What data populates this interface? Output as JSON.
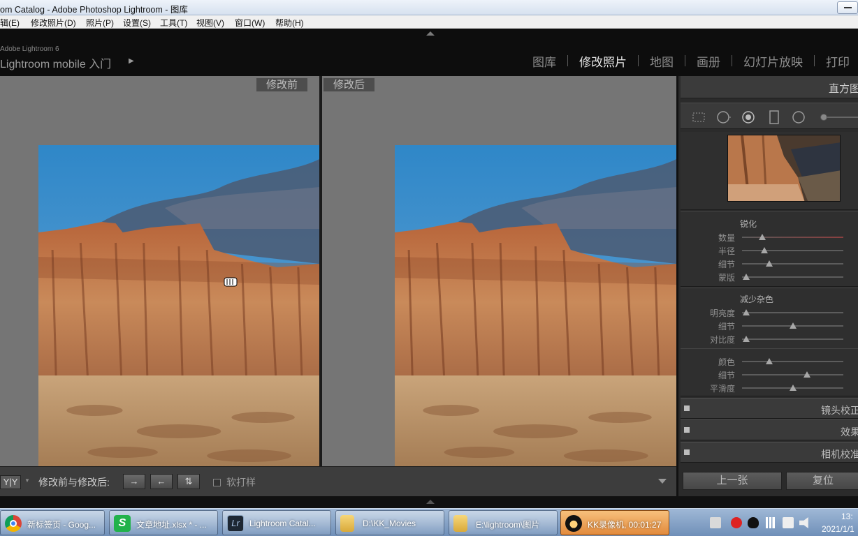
{
  "window": {
    "title": "om Catalog - Adobe Photoshop Lightroom - 图库"
  },
  "menu": [
    {
      "label": "辑(E)"
    },
    {
      "label": "修改照片(D)"
    },
    {
      "label": "照片(P)"
    },
    {
      "label": "设置(S)"
    },
    {
      "label": "工具(T)"
    },
    {
      "label": "视图(V)"
    },
    {
      "label": "窗口(W)"
    },
    {
      "label": "帮助(H)"
    }
  ],
  "header": {
    "brand_small": "Adobe Lightroom 6",
    "brand": "Lightroom mobile 入门",
    "brand_arrow": "▶",
    "modules": [
      {
        "label": "图库",
        "active": false
      },
      {
        "label": "修改照片",
        "active": true
      },
      {
        "label": "地图",
        "active": false
      },
      {
        "label": "画册",
        "active": false
      },
      {
        "label": "幻灯片放映",
        "active": false
      },
      {
        "label": "打印",
        "active": false
      }
    ]
  },
  "view": {
    "before_label": "修改前",
    "after_label": "修改后"
  },
  "panel": {
    "header": "直方图",
    "sharpen": {
      "title": "锐化",
      "sliders": [
        {
          "label": "数量",
          "value": 0.2
        },
        {
          "label": "半径",
          "value": 0.22
        },
        {
          "label": "细节",
          "value": 0.27
        },
        {
          "label": "蒙版",
          "value": 0.04
        }
      ]
    },
    "noise": {
      "title": "减少杂色",
      "luminance": [
        {
          "label": "明亮度",
          "value": 0.04
        },
        {
          "label": "细节",
          "value": 0.5
        },
        {
          "label": "对比度",
          "value": 0.04
        }
      ],
      "color": [
        {
          "label": "颜色",
          "value": 0.27
        },
        {
          "label": "细节",
          "value": 0.64
        },
        {
          "label": "平滑度",
          "value": 0.5
        }
      ]
    },
    "collapsed": [
      {
        "label": "镜头校正"
      },
      {
        "label": "效果"
      },
      {
        "label": "相机校准"
      }
    ],
    "prev_button": "上一张",
    "reset_button": "复位"
  },
  "toolbar": {
    "view_mode": "Y|Y",
    "label": "修改前与修改后:",
    "btn1": "→",
    "btn2": "←",
    "btn3": "⇅",
    "softproof": "软打样"
  },
  "taskbar": {
    "tasks": [
      {
        "label": "新标签页 - Goog...",
        "icon": "chrome-icon"
      },
      {
        "label": "文章地址.xlsx * - ...",
        "icon": "spreadsheet-icon"
      },
      {
        "label": "Lightroom Catal...",
        "icon": "lightroom-icon"
      },
      {
        "label": "D:\\KK_Movies",
        "icon": "folder-icon"
      },
      {
        "label": "E:\\lightroom\\图片",
        "icon": "folder-icon"
      },
      {
        "label": "KK录像机, 00:01:27",
        "icon": "kk-recorder-icon",
        "active": true
      }
    ],
    "clock_time": "13:",
    "clock_date": "2021/1/1"
  }
}
